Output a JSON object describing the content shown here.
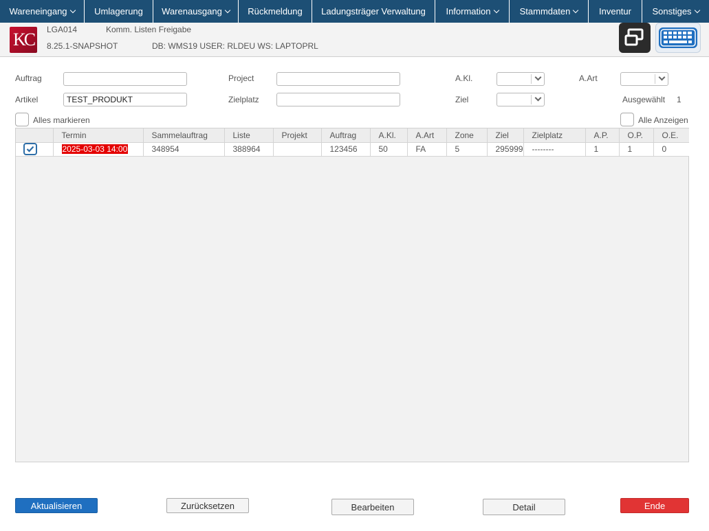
{
  "menu": [
    {
      "label": "Wareneingang",
      "dropdown": true
    },
    {
      "label": "Umlagerung",
      "dropdown": false
    },
    {
      "label": "Warenausgang",
      "dropdown": true
    },
    {
      "label": "Rückmeldung",
      "dropdown": false
    },
    {
      "label": "Ladungsträger Verwaltung",
      "dropdown": false
    },
    {
      "label": "Information",
      "dropdown": true
    },
    {
      "label": "Stammdaten",
      "dropdown": true
    },
    {
      "label": "Inventur",
      "dropdown": false
    },
    {
      "label": "Sonstiges",
      "dropdown": true
    }
  ],
  "header": {
    "logo_text": "KC",
    "screen_code": "LGA014",
    "screen_title": "Komm. Listen Freigabe",
    "version": "8.25.1-SNAPSHOT",
    "session_info": "DB: WMS19 USER: RLDEU WS: LAPTOPRL"
  },
  "filters": {
    "auftrag_label": "Auftrag",
    "auftrag_value": "",
    "artikel_label": "Artikel",
    "artikel_value": "TEST_PRODUKT",
    "project_label": "Project",
    "project_value": "",
    "zielplatz_label": "Zielplatz",
    "zielplatz_value": "",
    "akl_label": "A.Kl.",
    "ziel_label": "Ziel",
    "aart_label": "A.Art",
    "ausgewaehlt_label": "Ausgewählt",
    "ausgewaehlt_count": "1",
    "alles_markieren_label": "Alles markieren",
    "alle_anzeigen_label": "Alle Anzeigen"
  },
  "table": {
    "columns": [
      "",
      "Termin",
      "Sammelauftrag",
      "Liste",
      "Projekt",
      "Auftrag",
      "A.Kl.",
      "A.Art",
      "Zone",
      "Ziel",
      "Zielplatz",
      "A.P.",
      "O.P.",
      "O.E."
    ],
    "rows": [
      {
        "checked": true,
        "termin": "2025-03-03 14:00",
        "sammelauftrag": "348954",
        "liste": "388964",
        "projekt": "",
        "auftrag": "123456",
        "akl": "50",
        "aart": "FA",
        "zone": "5",
        "ziel": "295999",
        "zielplatz": "--------",
        "ap": "1",
        "op": "1",
        "oe": "0"
      }
    ]
  },
  "buttons": {
    "aktualisieren": "Aktualisieren",
    "zuruecksetzen": "Zurücksetzen",
    "bearbeiten": "Bearbeiten",
    "detail": "Detail",
    "ende": "Ende"
  },
  "colors": {
    "menu_bg": "#1d4f75",
    "termin_highlight": "#e40000",
    "primary": "#1f6fc0",
    "danger": "#e13434",
    "checkbox_accent": "#2e6ea8"
  }
}
